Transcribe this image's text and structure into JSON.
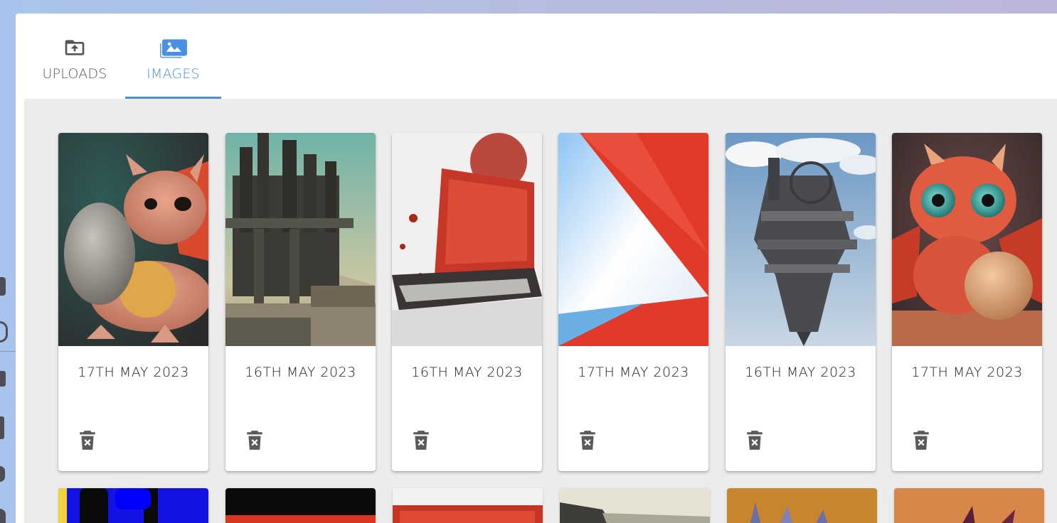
{
  "tabs": [
    {
      "label": "UPLOADS",
      "icon": "folder-upload-icon",
      "active": false
    },
    {
      "label": "IMAGES",
      "icon": "image-multiple-icon",
      "active": true
    }
  ],
  "colors": {
    "accent": "#4a90e2",
    "inactive_tab": "#555555",
    "content_bg": "#ececec",
    "delete_icon": "#5a5a5a"
  },
  "images": [
    {
      "date": "17TH MAY 2023",
      "subject": "baby-dragon-with-egg"
    },
    {
      "date": "16TH MAY 2023",
      "subject": "gothic-towers-city"
    },
    {
      "date": "16TH MAY 2023",
      "subject": "laptop-red-splash"
    },
    {
      "date": "17TH MAY 2023",
      "subject": "red-blue-abstract"
    },
    {
      "date": "16TH MAY 2023",
      "subject": "floating-steampunk-tower"
    },
    {
      "date": "17TH MAY 2023",
      "subject": "red-baby-dragon-egg"
    }
  ],
  "second_row": [
    {
      "subject": "blue-yellow-abstract"
    },
    {
      "subject": "black-red-screen"
    },
    {
      "subject": "red-device"
    },
    {
      "subject": "grey-landscape"
    },
    {
      "subject": "orange-creature"
    },
    {
      "subject": "orange-dragon"
    }
  ]
}
